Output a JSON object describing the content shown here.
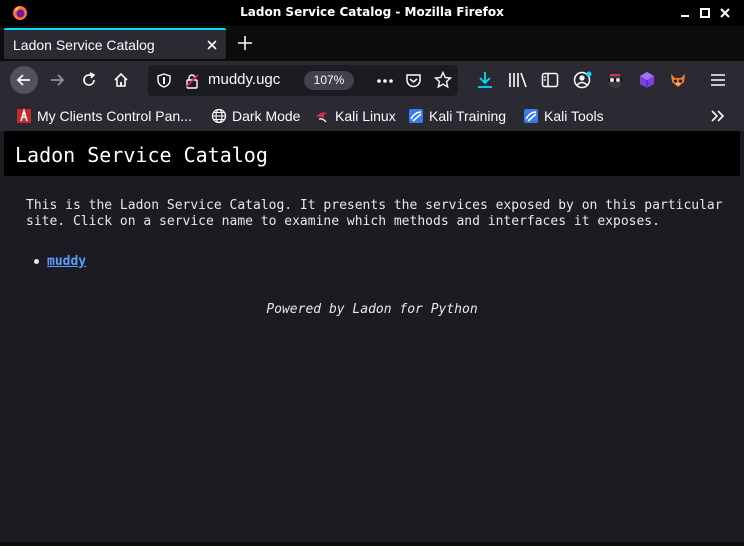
{
  "window": {
    "title": "Ladon Service Catalog - Mozilla Firefox"
  },
  "tabs": [
    {
      "label": "Ladon Service Catalog",
      "active": true
    }
  ],
  "navbar": {
    "url_text": "muddy.ugc",
    "zoom": "107%"
  },
  "bookmarks": [
    {
      "label": "My Clients Control Pan...",
      "icon": "client-panel-icon"
    },
    {
      "label": "Dark Mode",
      "icon": "globe-icon"
    },
    {
      "label": "Kali Linux",
      "icon": "kali-icon"
    },
    {
      "label": "Kali Training",
      "icon": "kali-training-icon"
    },
    {
      "label": "Kali Tools",
      "icon": "kali-tools-icon"
    }
  ],
  "page": {
    "heading": "Ladon Service Catalog",
    "intro": "This is the Ladon Service Catalog. It presents the services exposed by on this particular site. Click on a service name to examine which methods and interfaces it exposes.",
    "services": [
      "muddy"
    ],
    "footer": "Powered by Ladon for Python"
  },
  "colors": {
    "accent": "#00ddff",
    "link": "#5a9fff",
    "toolbar": "#2b2a33",
    "titlebar": "#000000"
  }
}
